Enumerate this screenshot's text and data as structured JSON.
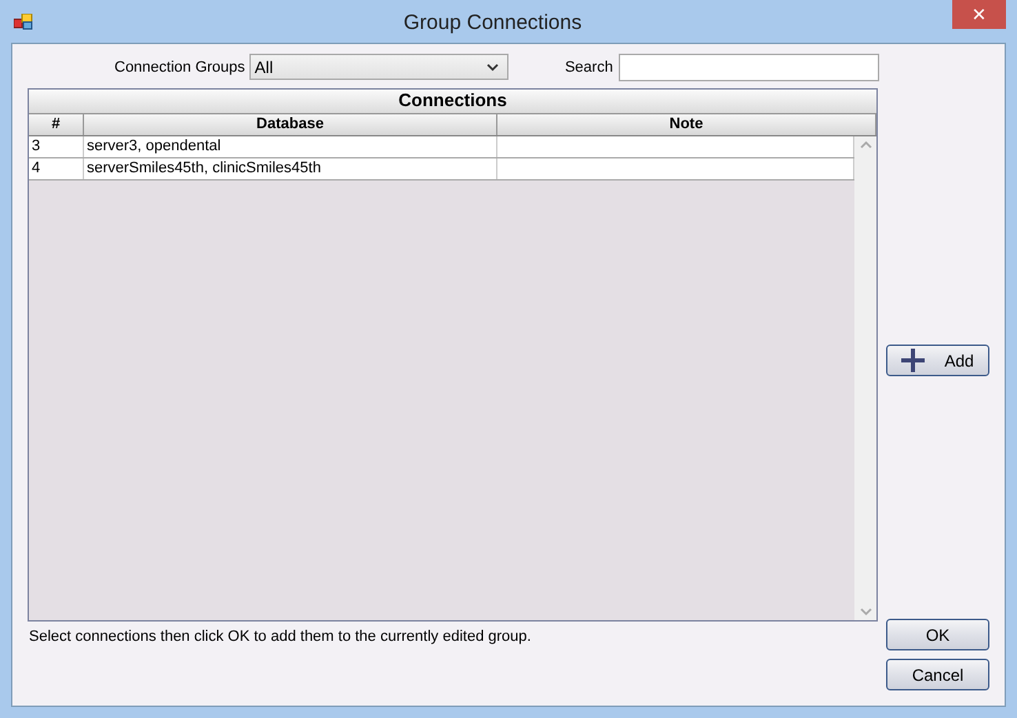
{
  "window": {
    "title": "Group Connections",
    "close": "✕"
  },
  "filter": {
    "label": "Connection Groups",
    "value": "All"
  },
  "search": {
    "label": "Search"
  },
  "grid": {
    "title": "Connections",
    "columns": [
      "#",
      "Database",
      "Note"
    ],
    "rows": [
      {
        "cells": [
          "3",
          "server3, opendental",
          null
        ]
      },
      {
        "cells": [
          "4",
          "serverSmiles45th, clinicSmiles45th",
          null
        ]
      }
    ]
  },
  "hint": "Select connections then click OK to add them to the currently edited group.",
  "buttons": {
    "add": "Add",
    "ok": "OK",
    "cancel": "Cancel"
  }
}
